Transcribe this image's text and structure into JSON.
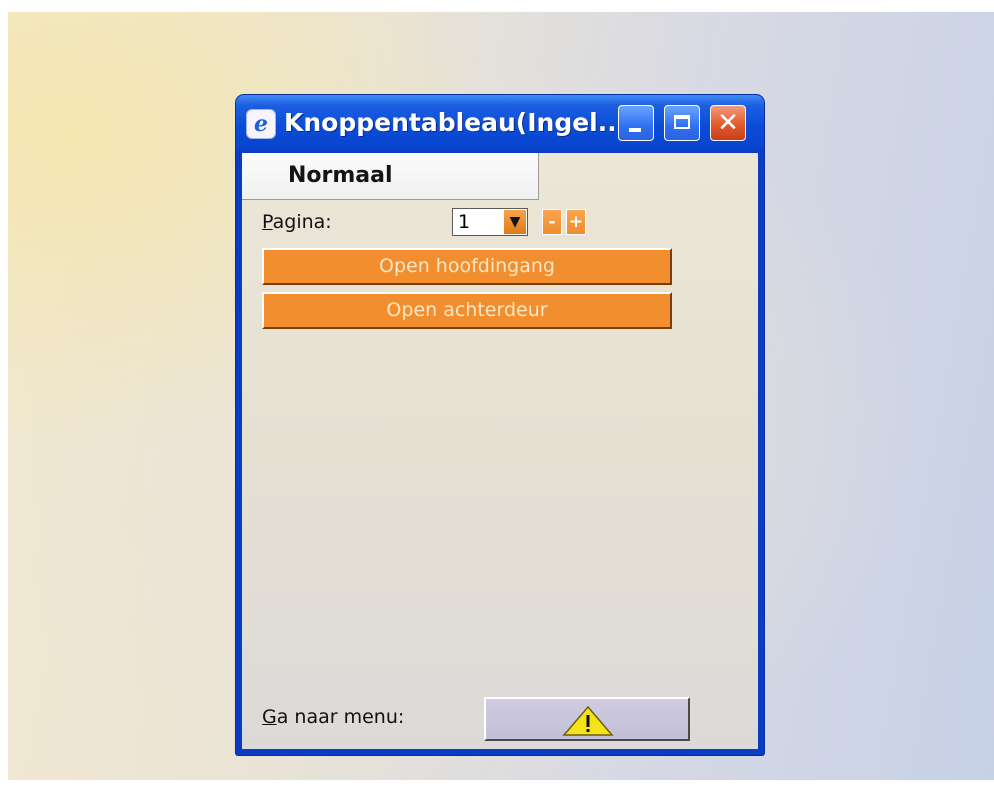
{
  "window": {
    "title": "Knoppentableau(Ingel...",
    "app_icon": "ie-icon",
    "controls": [
      "minimize-icon",
      "maximize-icon",
      "close-icon"
    ]
  },
  "mode": {
    "label": "Normaal"
  },
  "page": {
    "label_access_key": "P",
    "label_rest": "agina:",
    "selected": "1",
    "dropdown_icon": "chevron-down-icon",
    "minus_label": "-",
    "plus_label": "+"
  },
  "actions": [
    {
      "label": "Open hoofdingang"
    },
    {
      "label": "Open achterdeur"
    }
  ],
  "menu": {
    "label_access_key": "G",
    "label_rest": "a naar menu:",
    "button_icon": "warning-icon"
  },
  "colors": {
    "accent": "#f28e2e",
    "titlebar": "#0a4cd8",
    "close_button": "#e25a2c",
    "warning": "#f5e31a"
  }
}
